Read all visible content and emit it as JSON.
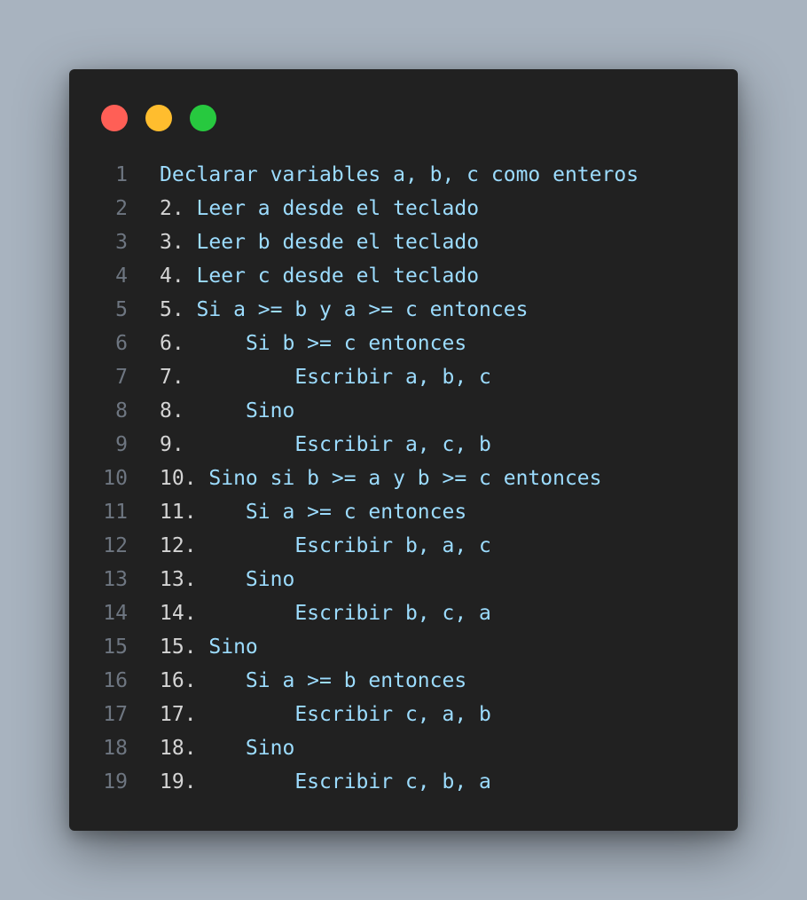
{
  "colors": {
    "background": "#a8b3bf",
    "window": "#212121",
    "dot_red": "#ff5f56",
    "dot_yellow": "#ffbd2e",
    "dot_green": "#27c93f",
    "line_number": "#6e7681",
    "list_number": "#d4d4d4",
    "code_text": "#9cdcfe"
  },
  "lines": [
    {
      "ln": "1",
      "num": "",
      "text": "Declarar variables a, b, c como enteros"
    },
    {
      "ln": "2",
      "num": "2.",
      "text": " Leer a desde el teclado"
    },
    {
      "ln": "3",
      "num": "3.",
      "text": " Leer b desde el teclado"
    },
    {
      "ln": "4",
      "num": "4.",
      "text": " Leer c desde el teclado"
    },
    {
      "ln": "5",
      "num": "5.",
      "text": " Si a >= b y a >= c entonces"
    },
    {
      "ln": "6",
      "num": "6.",
      "text": "     Si b >= c entonces"
    },
    {
      "ln": "7",
      "num": "7.",
      "text": "         Escribir a, b, c"
    },
    {
      "ln": "8",
      "num": "8.",
      "text": "     Sino"
    },
    {
      "ln": "9",
      "num": "9.",
      "text": "         Escribir a, c, b"
    },
    {
      "ln": "10",
      "num": "10.",
      "text": " Sino si b >= a y b >= c entonces"
    },
    {
      "ln": "11",
      "num": "11.",
      "text": "    Si a >= c entonces"
    },
    {
      "ln": "12",
      "num": "12.",
      "text": "        Escribir b, a, c"
    },
    {
      "ln": "13",
      "num": "13.",
      "text": "    Sino"
    },
    {
      "ln": "14",
      "num": "14.",
      "text": "        Escribir b, c, a"
    },
    {
      "ln": "15",
      "num": "15.",
      "text": " Sino"
    },
    {
      "ln": "16",
      "num": "16.",
      "text": "    Si a >= b entonces"
    },
    {
      "ln": "17",
      "num": "17.",
      "text": "        Escribir c, a, b"
    },
    {
      "ln": "18",
      "num": "18.",
      "text": "    Sino"
    },
    {
      "ln": "19",
      "num": "19.",
      "text": "        Escribir c, b, a"
    }
  ]
}
